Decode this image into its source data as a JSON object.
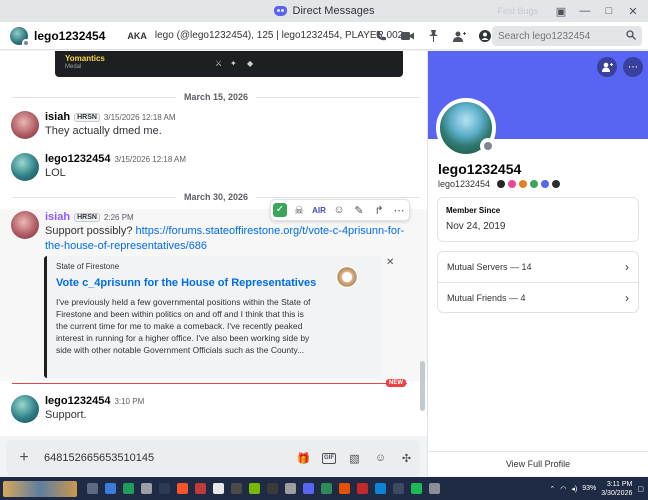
{
  "window": {
    "title": "Direct Messages",
    "ghost_text": "Find Bugs"
  },
  "header": {
    "username": "lego1232454",
    "aka_label": "AKA",
    "aka_names": "lego (@lego1232454), 125 | lego1232454, PLAYER 002",
    "search_placeholder": "Search lego1232454"
  },
  "chat": {
    "top_embed": {
      "title": "Yomantics",
      "subtitle": "Medal"
    },
    "dividers": [
      "March 15, 2026",
      "March 30, 2026"
    ],
    "messages": [
      {
        "author": "isiah",
        "tag": "HRSN",
        "time": "3/15/2026 12:18 AM",
        "text": "They actually dmed me."
      },
      {
        "author": "lego1232454",
        "time": "3/15/2026 12:18 AM",
        "text": "LOL"
      },
      {
        "author": "isiah",
        "tag": "HRSN",
        "time": "2:26 PM",
        "text_prefix": "Support possibly? ",
        "link": "https://forums.stateoffirestone.org/t/vote-c-4prisunn-for-the-house-of-representatives/686"
      },
      {
        "author": "lego1232454",
        "time": "3:10 PM",
        "text": "Support."
      }
    ],
    "hover_toolbar": {
      "air_label": "AIR"
    },
    "embed": {
      "provider": "State of Firestone",
      "title": "Vote c_4prisunn for the House of Representatives",
      "description": "I've previously held a few governmental positions within the State of Firestone and been within politics on and off and I think that this is the current time for me to make a comeback. I've recently peaked interest in running for a higher office. I've also been working side by side with other notable Government Officials such as the County..."
    },
    "new_badge": "NEW"
  },
  "composer": {
    "value": "648152665653510145",
    "gif_label": "GIF"
  },
  "profile": {
    "display_name": "lego1232454",
    "username": "lego1232454",
    "member_since_label": "Member Since",
    "member_since_value": "Nov 24, 2019",
    "mutual_servers": "Mutual Servers — 14",
    "mutual_friends": "Mutual Friends — 4",
    "footer": "View Full Profile"
  },
  "taskbar": {
    "battery": "93%",
    "time": "3:11 PM",
    "date": "3/30/2026"
  },
  "colors": {
    "banner": "#5865f2",
    "link": "#006ce7",
    "new": "#f23f43",
    "taskbar": "#1f2a44"
  }
}
